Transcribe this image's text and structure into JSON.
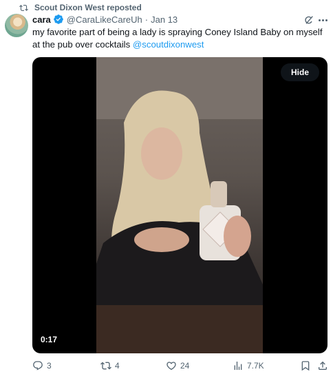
{
  "repost_banner": {
    "text": "Scout Dixon West reposted",
    "icon": "repost-icon"
  },
  "author": {
    "name": "cara",
    "handle": "@CaraLikeCareUh",
    "separator": "·",
    "date": "Jan 13",
    "verified_icon": "verified-badge-icon",
    "avatar_icon": "avatar"
  },
  "header_buttons": {
    "grok_icon": "grok-icon",
    "more_icon": "more-icon"
  },
  "tweet": {
    "text": "my favorite part of being a lady is spraying Coney Island Baby on myself at the pub over cocktails ",
    "mention": "@scoutdixonwest"
  },
  "media": {
    "hide_label": "Hide",
    "timestamp": "0:17"
  },
  "actions": {
    "reply_count": "3",
    "repost_count": "4",
    "like_count": "24",
    "views_count": "7.7K"
  },
  "colors": {
    "accent": "#1d9bf0",
    "secondary_text": "#536471",
    "primary_text": "#0f1419"
  }
}
